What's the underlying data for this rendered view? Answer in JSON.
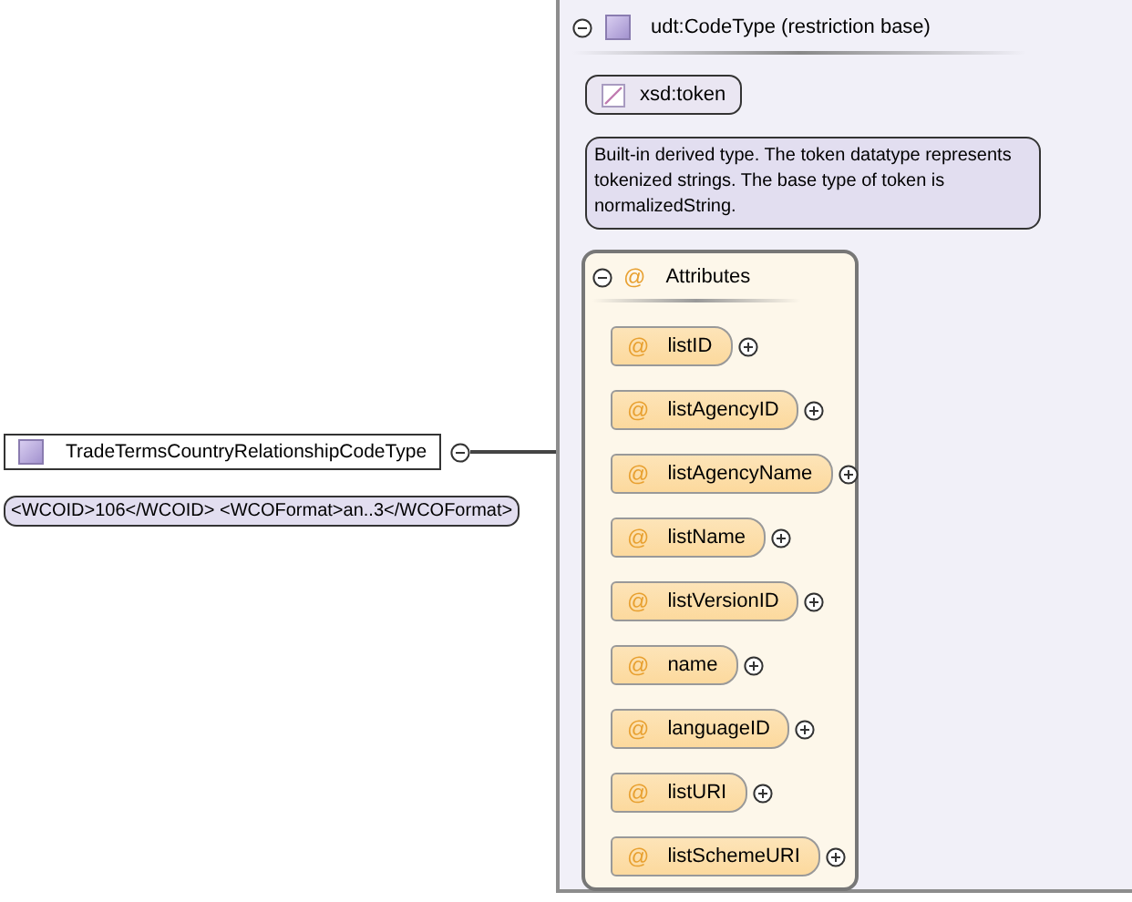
{
  "element": {
    "name": "TradeTermsCountryRelationshipCodeType",
    "expanded": true,
    "annotation": "<WCOID>106</WCOID> <WCOFormat>an..3</WCOFormat>"
  },
  "type": {
    "name": "udt:CodeType (restriction base)",
    "expanded": true
  },
  "base": {
    "name": "xsd:token",
    "documentation": "Built-in derived type. The token datatype represents tokenized strings. The base type of token is normalizedString."
  },
  "attributes": {
    "symbol": "@",
    "title": "Attributes",
    "expanded": true,
    "items": [
      {
        "symbol": "@",
        "name": "listID",
        "expanded": false
      },
      {
        "symbol": "@",
        "name": "listAgencyID",
        "expanded": false
      },
      {
        "symbol": "@",
        "name": "listAgencyName",
        "expanded": false
      },
      {
        "symbol": "@",
        "name": "listName",
        "expanded": false
      },
      {
        "symbol": "@",
        "name": "listVersionID",
        "expanded": false
      },
      {
        "symbol": "@",
        "name": "name",
        "expanded": false
      },
      {
        "symbol": "@",
        "name": "languageID",
        "expanded": false
      },
      {
        "symbol": "@",
        "name": "listURI",
        "expanded": false
      },
      {
        "symbol": "@",
        "name": "listSchemeURI",
        "expanded": false
      }
    ]
  }
}
